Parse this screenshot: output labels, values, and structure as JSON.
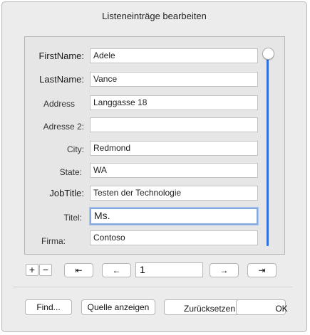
{
  "dialog": {
    "title": "Listeneinträge bearbeiten"
  },
  "fields": [
    {
      "label": "FirstName:",
      "value": "Adele"
    },
    {
      "label": "LastName:",
      "value": "Vance"
    },
    {
      "label": "Address",
      "value": "Langgasse 18"
    },
    {
      "label": "Adresse 2:",
      "value": ""
    },
    {
      "label": "City:",
      "value": "Redmond"
    },
    {
      "label": "State:",
      "value": "WA"
    },
    {
      "label": "JobTitle:",
      "value": "Testen der Technologie"
    },
    {
      "label": "Titel:",
      "value": "Ms."
    },
    {
      "label": "Firma:",
      "value": "Contoso"
    }
  ],
  "record_nav": {
    "add_label": "+",
    "remove_label": "−",
    "first_label": "⇤",
    "prev_label": "←",
    "record_number": "1",
    "next_label": "→",
    "last_label": "⇥"
  },
  "buttons": {
    "find": "Find...",
    "view_source": "Quelle anzeigen",
    "reset": "Zurücksetzen",
    "ok": "OK"
  },
  "colors": {
    "slider_track": "#2f6fde",
    "focus_ring": "#84a9e0",
    "dialog_bg": "#ececec"
  }
}
